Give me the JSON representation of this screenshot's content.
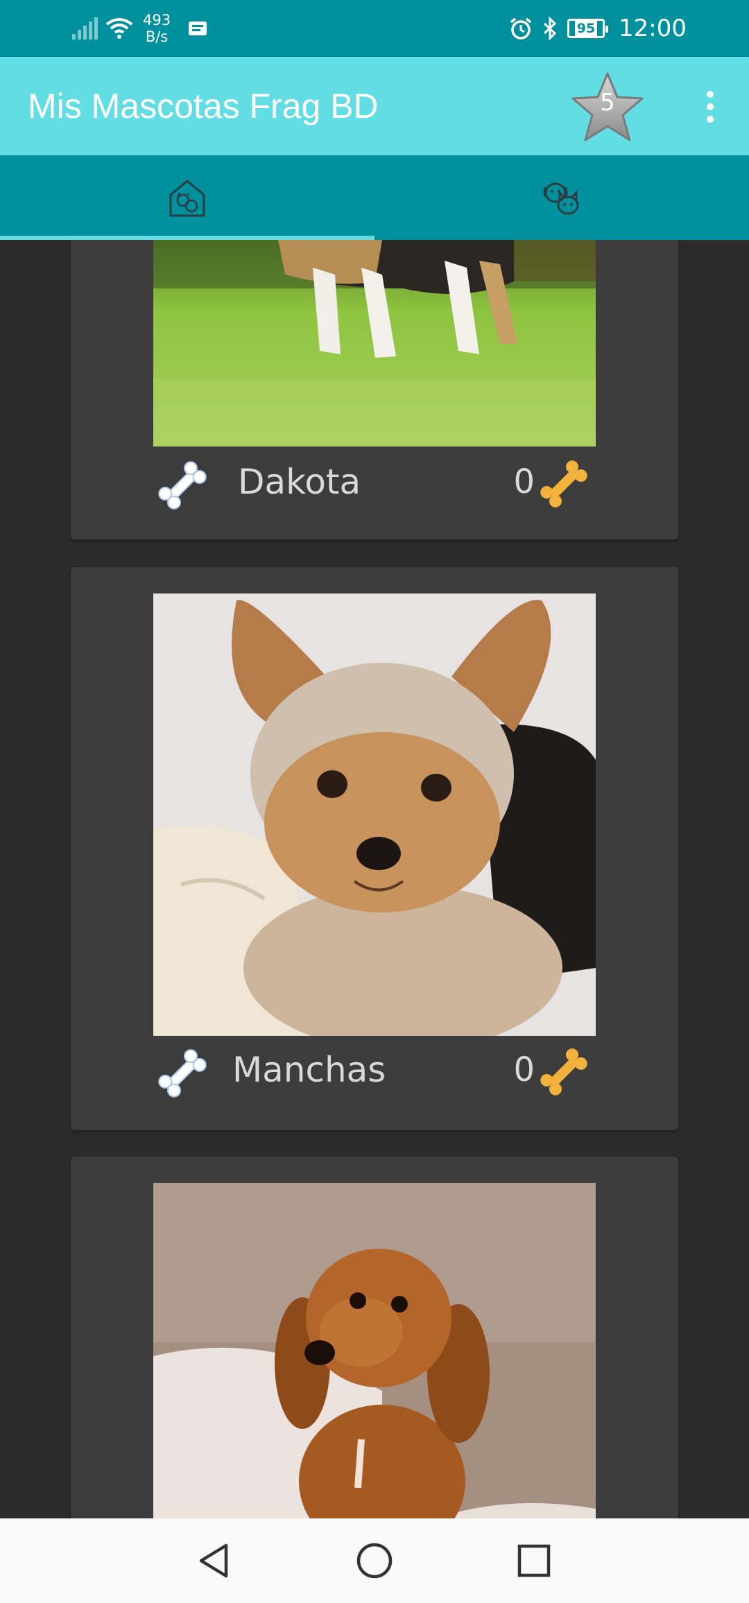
{
  "status_bar": {
    "net_speed_value": "493",
    "net_speed_unit": "B/s",
    "battery": "95",
    "time": "12:00"
  },
  "app_bar": {
    "title": "Mis Mascotas Frag BD",
    "favorites_count": "5"
  },
  "tabs": [
    {
      "icon": "home-pet-icon",
      "selected": true
    },
    {
      "icon": "dog-cat-icon",
      "selected": false
    }
  ],
  "pets": [
    {
      "name": "Dakota",
      "likes": "0",
      "photo": "beagle-legs-on-grass"
    },
    {
      "name": "Manchas",
      "likes": "0",
      "photo": "yorkshire-terrier"
    },
    {
      "name": "",
      "likes": "",
      "photo": "cocker-spaniel-puppy"
    }
  ],
  "colors": {
    "status_bar": "#00909e",
    "app_bar": "#62dde4",
    "tab_bar": "#00909e",
    "background": "#2b2b2b",
    "card": "#3c3c3c",
    "bone_gold": "#f3b23b",
    "bone_white": "#ffffff"
  }
}
